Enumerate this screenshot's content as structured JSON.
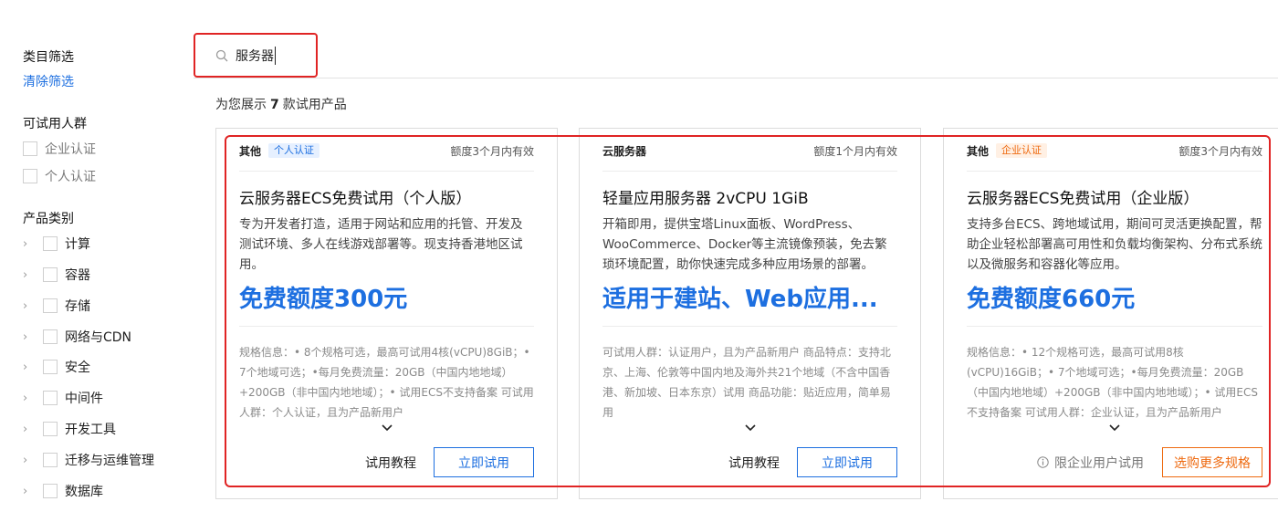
{
  "sidebar": {
    "filter_title": "类目筛选",
    "clear_link": "清除筛选",
    "audience_title": "可试用人群",
    "audience": [
      {
        "label": "企业认证"
      },
      {
        "label": "个人认证"
      }
    ],
    "category_title": "产品类别",
    "categories": [
      {
        "label": "计算"
      },
      {
        "label": "容器"
      },
      {
        "label": "存储"
      },
      {
        "label": "网络与CDN"
      },
      {
        "label": "安全"
      },
      {
        "label": "中间件"
      },
      {
        "label": "开发工具"
      },
      {
        "label": "迁移与运维管理"
      },
      {
        "label": "数据库"
      }
    ]
  },
  "search": {
    "value": "服务器",
    "icon": "search-icon"
  },
  "results": {
    "prefix": "为您展示",
    "count": "7",
    "suffix": "款试用产品"
  },
  "colors": {
    "accent": "#1d6fe0",
    "highlight": "#e02424",
    "orange": "#ee6a10"
  },
  "cards": [
    {
      "category": "其他",
      "badge": "个人认证",
      "quota": "额度3个月内有效",
      "title": "云服务器ECS免费试用（个人版）",
      "desc": "专为开发者打造，适用于网站和应用的托管、开发及测试环境、多人在线游戏部署等。现支持香港地区试用。",
      "price": "免费额度300元",
      "spec": "规格信息：• 8个规格可选，最高可试用4核(vCPU)8GiB；• 7个地域可选；•每月免费流量：20GB（中国内地地域）+200GB（非中国内地地域）；• 试用ECS不支持备案 可试用人群：个人认证，且为产品新用户",
      "tutorial": "试用教程",
      "button": "立即试用"
    },
    {
      "category": "云服务器",
      "quota": "额度1个月内有效",
      "title": "轻量应用服务器 2vCPU 1GiB",
      "desc": "开箱即用，提供宝塔Linux面板、WordPress、WooCommerce、Docker等主流镜像预装，免去繁琐环境配置，助你快速完成多种应用场景的部署。",
      "price": "适用于建站、Web应用...",
      "spec": "可试用人群：认证用户，且为产品新用户 商品特点：支持北京、上海、伦敦等中国内地及海外共21个地域（不含中国香港、新加坡、日本东京）试用 商品功能：贴近应用，简单易用",
      "tutorial": "试用教程",
      "button": "立即试用"
    },
    {
      "category": "其他",
      "badge": "企业认证",
      "quota": "额度3个月内有效",
      "title": "云服务器ECS免费试用（企业版）",
      "desc": "支持多台ECS、跨地域试用，期间可灵活更换配置，帮助企业轻松部署高可用性和负载均衡架构、分布式系统以及微服务和容器化等应用。",
      "price": "免费额度660元",
      "spec": "规格信息：• 12个规格可选，最高可试用8核(vCPU)16GiB；• 7个地域可选；•每月免费流量：20GB（中国内地地域）+200GB（非中国内地地域）；• 试用ECS不支持备案 可试用人群：企业认证，且为产品新用户",
      "note": "限企业用户试用",
      "button": "选购更多规格"
    }
  ]
}
